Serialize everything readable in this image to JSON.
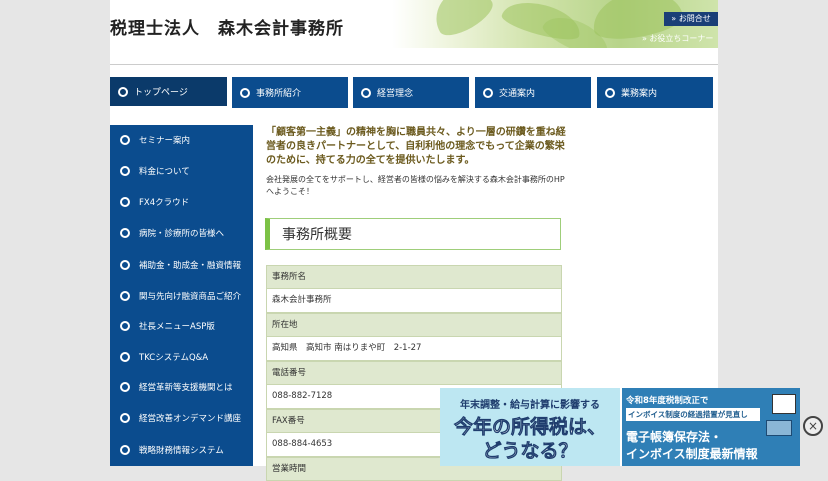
{
  "header": {
    "site_title": "税理士法人　森木会計事務所",
    "contact_label": "» お問合せ",
    "useful_corner": "» お役立ちコーナー"
  },
  "nav": [
    {
      "label": "トップページ",
      "active": true
    },
    {
      "label": "事務所紹介"
    },
    {
      "label": "経営理念"
    },
    {
      "label": "交通案内"
    },
    {
      "label": "業務案内"
    }
  ],
  "sidebar": [
    {
      "label": "セミナー案内"
    },
    {
      "label": "料金について"
    },
    {
      "label": "FX4クラウド"
    },
    {
      "label": "病院・診療所の皆様へ"
    },
    {
      "label": "補助金・助成金・融資情報"
    },
    {
      "label": "関与先向け融資商品ご紹介"
    },
    {
      "label": "社長メニューASP版"
    },
    {
      "label": "TKCシステムQ&A"
    },
    {
      "label": "経営革新等支援機関とは"
    },
    {
      "label": "経営改善オンデマンド講座"
    },
    {
      "label": "戦略財務情報システム"
    }
  ],
  "main": {
    "intro": "「顧客第一主義」の精神を胸に職員共々、より一層の研鑽を重ね経営者の良きパートナーとして、自利利他の理念でもって企業の繁栄のために、持てる力の全てを提供いたします。",
    "welcome": "会社発展の全てをサポートし、経営者の皆様の悩みを解決する森木会計事務所のHPへようこそ！",
    "section_title": "事務所概要",
    "overview": [
      {
        "label": "事務所名",
        "value": "森木会計事務所"
      },
      {
        "label": "所在地",
        "value": "高知県　高知市 南はりまや町　2-1-27"
      },
      {
        "label": "電話番号",
        "value": "088-882-7128"
      },
      {
        "label": "FAX番号",
        "value": "088-884-4653"
      },
      {
        "label": "営業時間",
        "value": ""
      }
    ]
  },
  "banners": {
    "left": {
      "line1": "年末調整・給与計算に影響する",
      "line2": "今年の所得税は、",
      "line3": "どうなる？"
    },
    "right": {
      "line1": "令和8年度税制改正で",
      "line2": "インボイス制度の経過措置が見直し",
      "line3": "電子帳簿保存法・",
      "line4": "インボイス制度最新情報"
    },
    "close_label": "×"
  },
  "colors": {
    "nav_blue": "#0b4c8e",
    "intro_text": "#6b5a1e",
    "table_label_bg": "#dfe8cf",
    "section_accent": "#7cc246"
  }
}
